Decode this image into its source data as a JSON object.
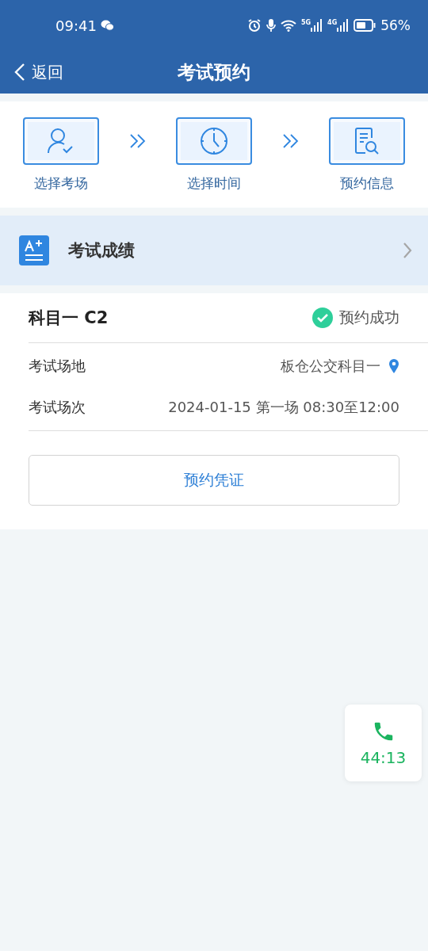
{
  "status_bar": {
    "time": "09:41",
    "network_labels": [
      "5G",
      "4G"
    ],
    "battery": "56%"
  },
  "nav": {
    "back": "返回",
    "title": "考试预约"
  },
  "steps": [
    {
      "kind": "person",
      "label": "选择考场"
    },
    {
      "kind": "clock",
      "label": "选择时间"
    },
    {
      "kind": "document",
      "label": "预约信息"
    }
  ],
  "score_link": {
    "label": "考试成绩"
  },
  "booking": {
    "subject": "科目一 C2",
    "status": "预约成功",
    "fields": [
      {
        "label": "考试场地",
        "value": "板仓公交科目一",
        "kind": "location"
      },
      {
        "label": "考试场次",
        "value": "2024-01-15 第一场 08:30至12:00",
        "kind": "plain"
      }
    ],
    "voucher_button": "预约凭证"
  },
  "call_widget": {
    "duration": "44:13"
  }
}
